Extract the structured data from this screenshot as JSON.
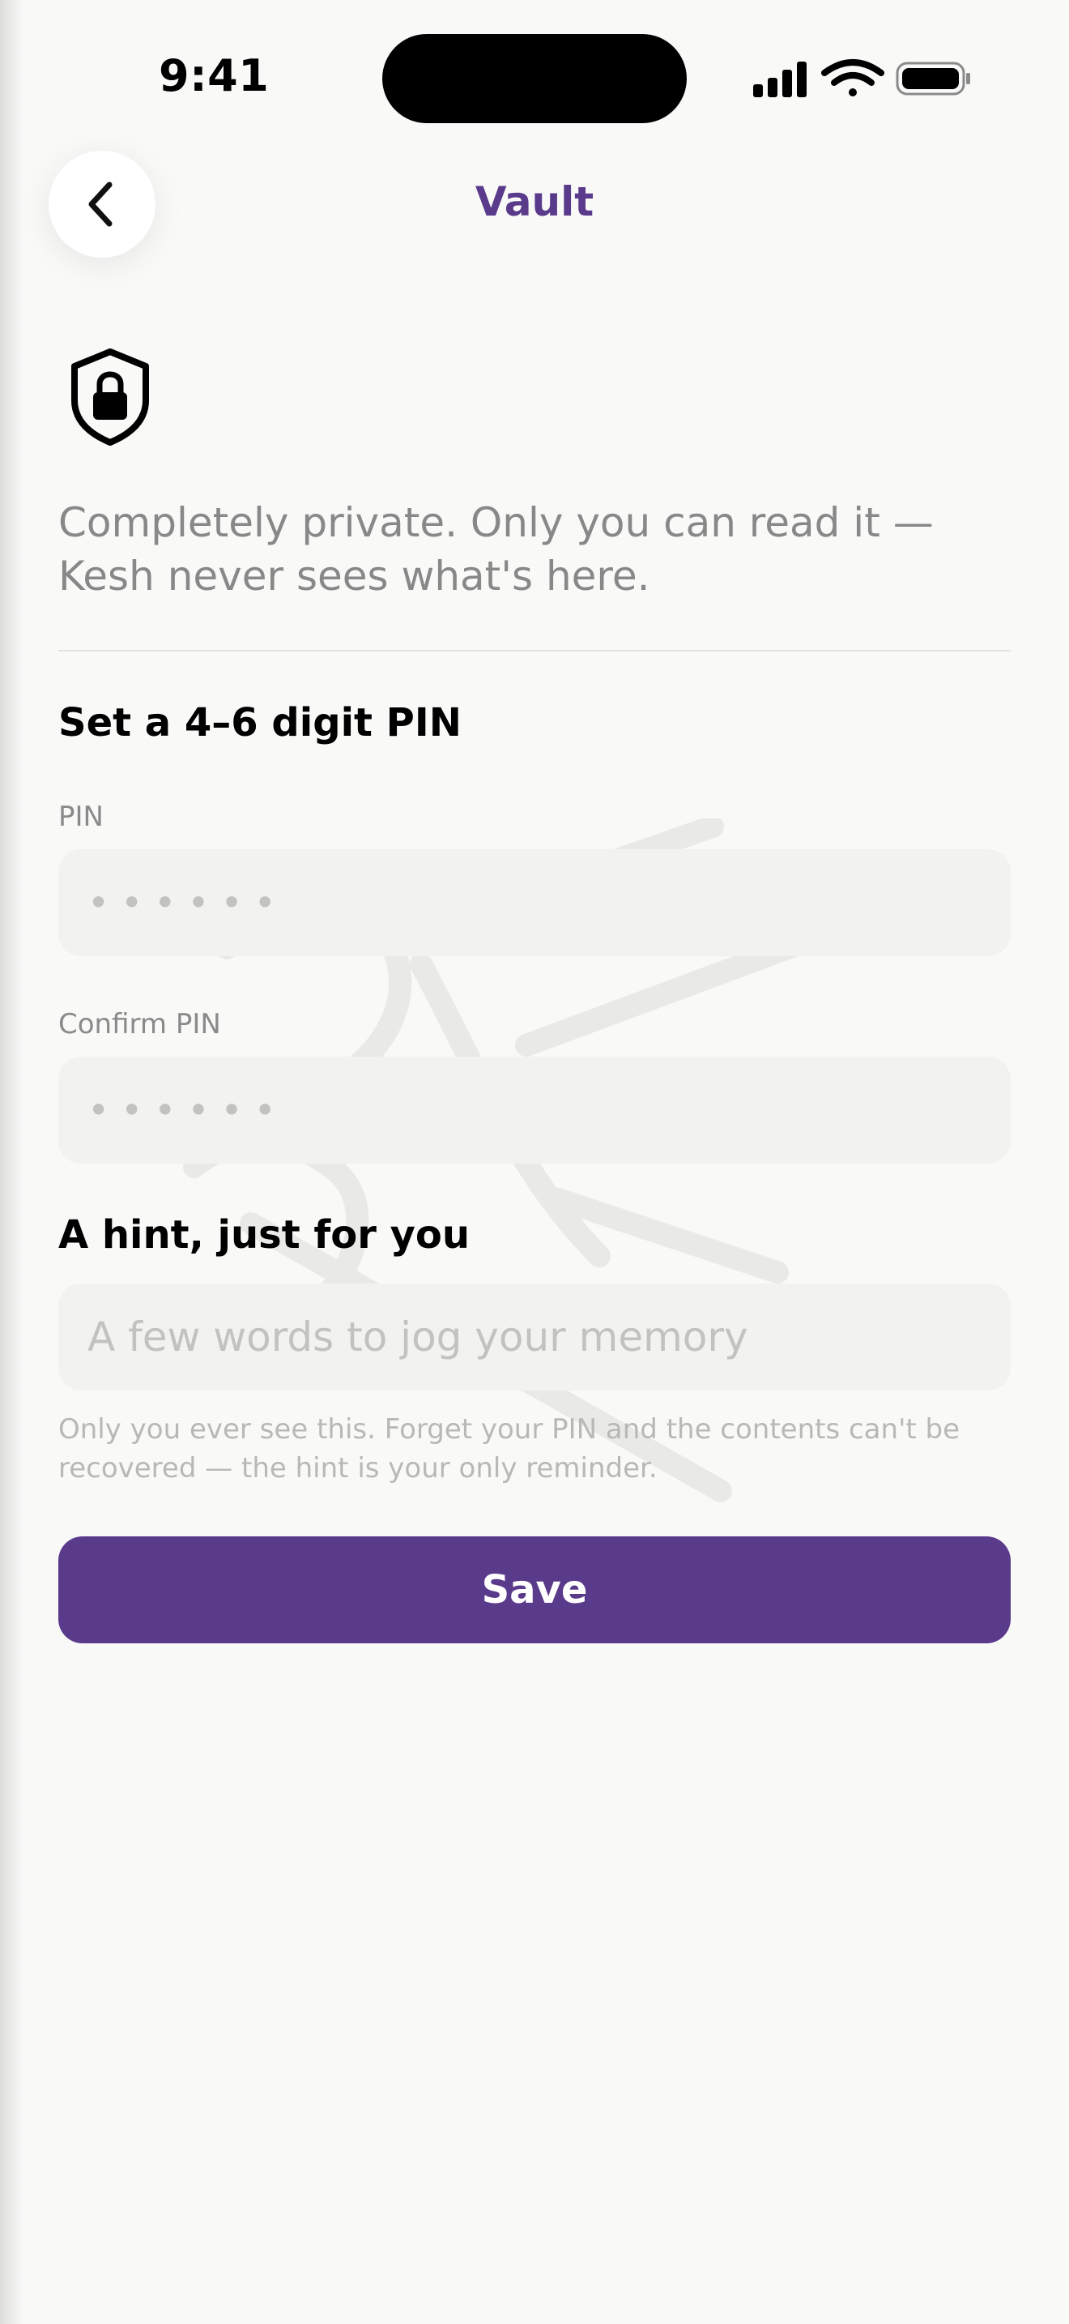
{
  "status_bar": {
    "time": "9:41",
    "icons": [
      "signal-icon",
      "wifi-icon",
      "battery-icon"
    ]
  },
  "header": {
    "title": "Vault",
    "back_icon": "chevron-left-icon"
  },
  "intro": {
    "icon": "shield-lock-icon",
    "text": "Completely private. Only you can read it — Kesh never sees what's here."
  },
  "pin_section": {
    "title": "Set a 4–6 digit PIN",
    "pin_label": "PIN",
    "pin_placeholder": "••••••",
    "confirm_label": "Confirm PIN",
    "confirm_placeholder": "••••••"
  },
  "hint_section": {
    "title": "A hint, just for you",
    "placeholder": "A few words to jog your memory",
    "note": "Only you ever see this. Forget your PIN and the contents can't be recovered — the hint is your only reminder."
  },
  "actions": {
    "save_label": "Save"
  },
  "colors": {
    "accent": "#5a3a8a",
    "background": "#f9f9f8",
    "field": "#f2f2f0"
  }
}
